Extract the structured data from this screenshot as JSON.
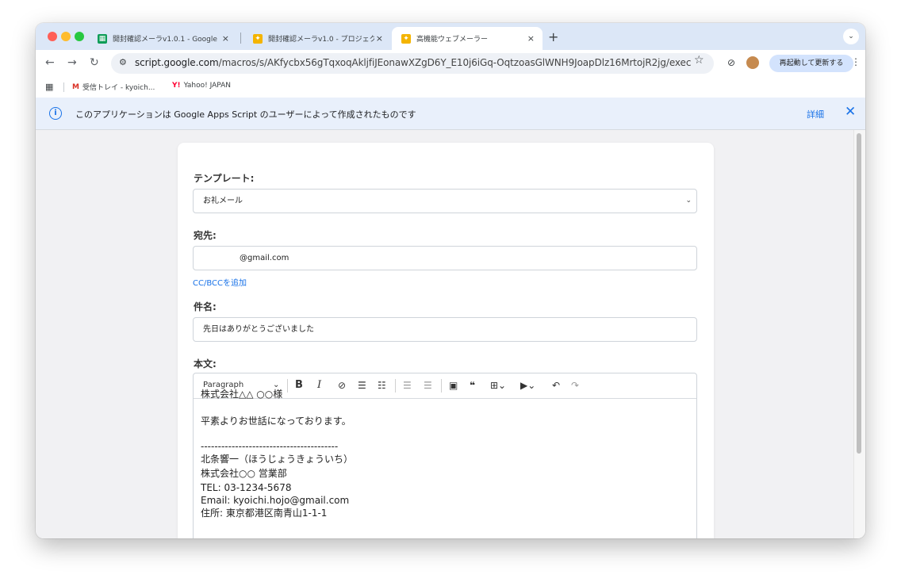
{
  "tabs": [
    {
      "title": "開封確認メーラv1.0.1 - Google",
      "close": "×",
      "favicon_color": "#0f9d58",
      "favicon_icon": "sheets-icon"
    },
    {
      "title": "開封確認メーラv1.0 - プロジェク",
      "close": "×",
      "favicon_color": "#f4b400",
      "favicon_icon": "apps-script-icon"
    },
    {
      "title": "高機能ウェブメーラー",
      "close": "×",
      "favicon_color": "#f4b400",
      "favicon_icon": "apps-script-icon"
    }
  ],
  "new_tab_glyph": "+",
  "address": {
    "host": "script.google.com",
    "path": "/macros/s/AKfycbx56gTqxoqAkljfiJEonawXZgD6Y_E10j6iGq-OqtzoasGlWNH9JoapDlz16MrtojR2jg/exec"
  },
  "relaunch_label": "再起動して更新する",
  "bookmarks": [
    {
      "label": "受信トレイ - kyoich...",
      "icon": "gmail-icon"
    },
    {
      "label": "Yahoo! JAPAN",
      "icon": "yahoo-icon"
    }
  ],
  "infobar": {
    "text": "このアプリケーションは Google Apps Script のユーザーによって作成されたものです",
    "details": "詳細",
    "close": "✕"
  },
  "form": {
    "template_label": "テンプレート:",
    "template_value": "お礼メール",
    "to_label": "宛先:",
    "to_value": "@gmail.com",
    "ccbcc_link": "CC/BCCを追加",
    "subject_label": "件名:",
    "subject_value": "先日はありがとうございました",
    "body_label": "本文:",
    "paragraph_select": "Paragraph",
    "body_lines": [
      "株式会社△△ ○○様",
      "",
      "平素よりお世話になっております。",
      "",
      "----------------------------------------",
      "北条響一（ほうじょうきょういち）",
      "株式会社○○ 営業部",
      "TEL: 03-1234-5678",
      "Email: kyoichi.hojo@gmail.com",
      "住所: 東京都港区南青山1-1-1"
    ]
  },
  "colors": {
    "accent": "#1a73e8",
    "tabstrip": "#dce7f7",
    "infobar": "#e9f0fb",
    "page_bg": "#f1f1f3"
  }
}
